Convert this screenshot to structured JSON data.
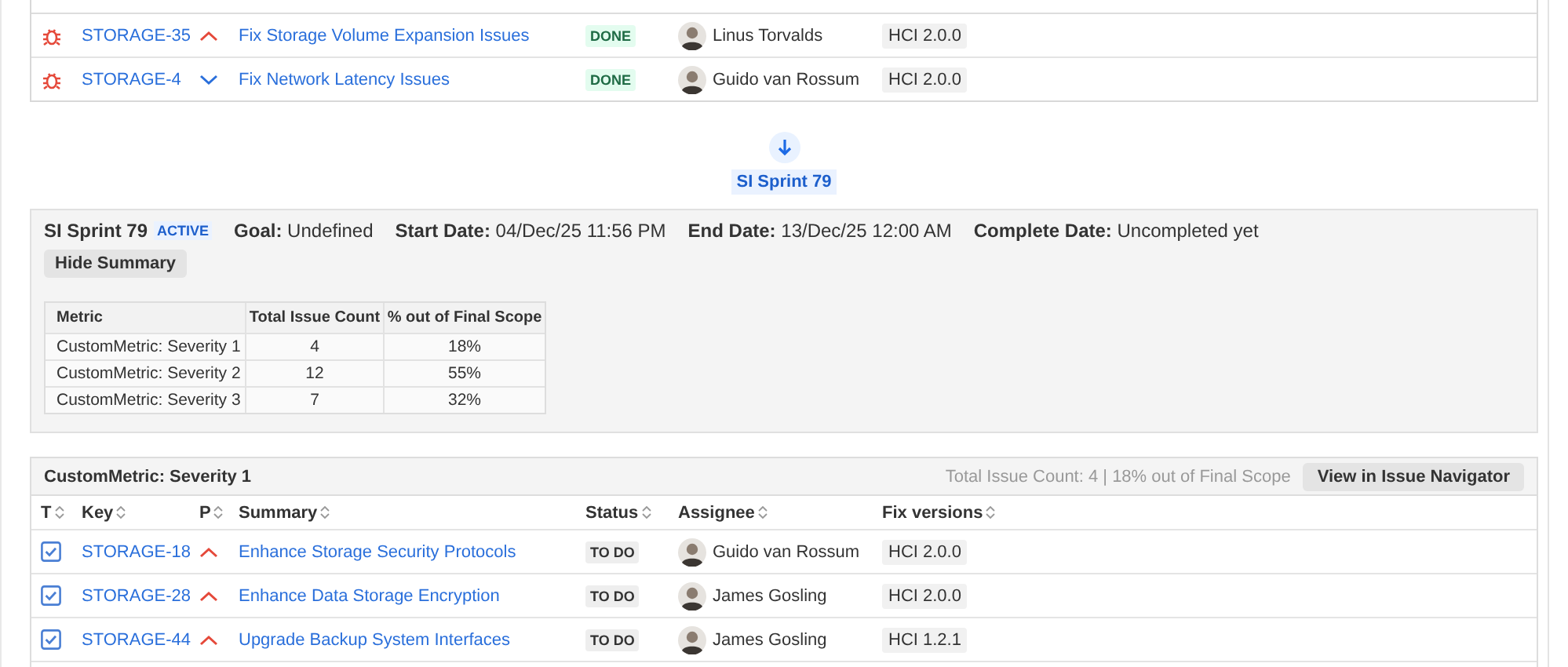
{
  "top_issues": [
    {
      "type": {
        "kind": "bug"
      },
      "key": "STORAGE-35",
      "priority": {
        "kind": "high"
      },
      "summary": "Fix Storage Volume Expansion Issues",
      "status": {
        "kind": "done",
        "label": "DONE"
      },
      "assignee": "Linus Torvalds",
      "fix_version": "HCI 2.0.0"
    },
    {
      "type": {
        "kind": "bug"
      },
      "key": "STORAGE-4",
      "priority": {
        "kind": "low"
      },
      "summary": "Fix Network Latency Issues",
      "status": {
        "kind": "done",
        "label": "DONE"
      },
      "assignee": "Guido van Rossum",
      "fix_version": "HCI 2.0.0"
    }
  ],
  "sprint_link": "SI Sprint 79",
  "sprint": {
    "name": "SI Sprint 79",
    "state": "ACTIVE",
    "fields": [
      {
        "label": "Goal:",
        "value": "Undefined"
      },
      {
        "label": "Start Date:",
        "value": "04/Dec/25 11:56 PM"
      },
      {
        "label": "End Date:",
        "value": "13/Dec/25 12:00 AM"
      },
      {
        "label": "Complete Date:",
        "value": "Uncompleted yet"
      }
    ],
    "summary_button": "Hide Summary",
    "summary_table": {
      "columns": [
        "Metric",
        "Total Issue Count",
        "% out of Final Scope"
      ],
      "rows": [
        [
          "CustomMetric: Severity 1",
          "4",
          "18%"
        ],
        [
          "CustomMetric: Severity 2",
          "12",
          "55%"
        ],
        [
          "CustomMetric: Severity 3",
          "7",
          "32%"
        ]
      ]
    }
  },
  "group": {
    "title": "CustomMetric: Severity 1",
    "stats": "Total Issue Count: 4 | 18% out of Final Scope",
    "navigator_button": "View in Issue Navigator",
    "columns": [
      "T",
      "Key",
      "P",
      "Summary",
      "Status",
      "Assignee",
      "Fix versions"
    ],
    "issues": [
      {
        "type": {
          "kind": "story"
        },
        "key": "STORAGE-18",
        "priority": {
          "kind": "high"
        },
        "summary": "Enhance Storage Security Protocols",
        "status": {
          "kind": "todo",
          "label": "TO DO"
        },
        "assignee": "Guido van Rossum",
        "fix_version": "HCI 2.0.0"
      },
      {
        "type": {
          "kind": "story"
        },
        "key": "STORAGE-28",
        "priority": {
          "kind": "high"
        },
        "summary": "Enhance Data Storage Encryption",
        "status": {
          "kind": "todo",
          "label": "TO DO"
        },
        "assignee": "James Gosling",
        "fix_version": "HCI 2.0.0"
      },
      {
        "type": {
          "kind": "story"
        },
        "key": "STORAGE-44",
        "priority": {
          "kind": "high"
        },
        "summary": "Upgrade Backup System Interfaces",
        "status": {
          "kind": "todo",
          "label": "TO DO"
        },
        "assignee": "James Gosling",
        "fix_version": "HCI 1.2.1"
      }
    ]
  }
}
